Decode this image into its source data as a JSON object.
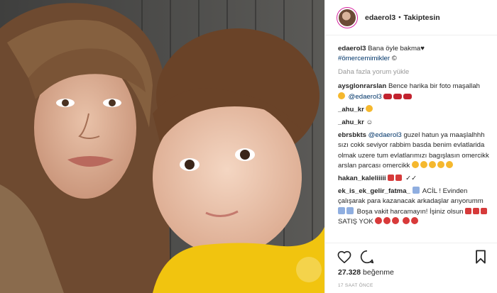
{
  "post": {
    "author": "edaerol3",
    "separator": "•",
    "follow_state": "Takiptesin"
  },
  "caption": {
    "author": "edaerol3",
    "text": "Bana öyle bakma♥",
    "hashtag": "#ömercemimikler",
    "hashtag_icon": "©"
  },
  "load_more": "Daha fazla yorum yükle",
  "comments": [
    {
      "user": "aysglonrarslan",
      "text": "Bence harika bir foto maşallah",
      "mention": "@edaerol3"
    },
    {
      "user": "_ahu_kr",
      "text": ""
    },
    {
      "user": "_ahu_kr",
      "text": "☺"
    },
    {
      "user": "ebrsbkts",
      "mention": "@edaerol3",
      "text": "guzel hatun ya maaşlalhhh sızı cokk seviyor rabbim basda benim evlatlarida olmak uzere tum evlatlarımızı bagışlasın omercikk arslan parcası omercikk"
    },
    {
      "user": "hakan_kaleliiiii",
      "text": "✓✓"
    },
    {
      "user": "ek_is_ek_gelir_fatma_",
      "text_1": "ACİL ! Evinden çalışarak para kazanacak arkadaşlar arıyorumm",
      "text_2": "Boşa vakit harcamayın! İşiniz olsun",
      "text_3": "SATIŞ YOK"
    }
  ],
  "likes": {
    "count": "27.328",
    "label": "beğenme"
  },
  "timestamp": "17 SAAT ÖNCE",
  "icons": {
    "like": "heart-icon",
    "comment": "comment-bubble-icon",
    "save": "bookmark-icon",
    "avatar": "profile-avatar"
  }
}
